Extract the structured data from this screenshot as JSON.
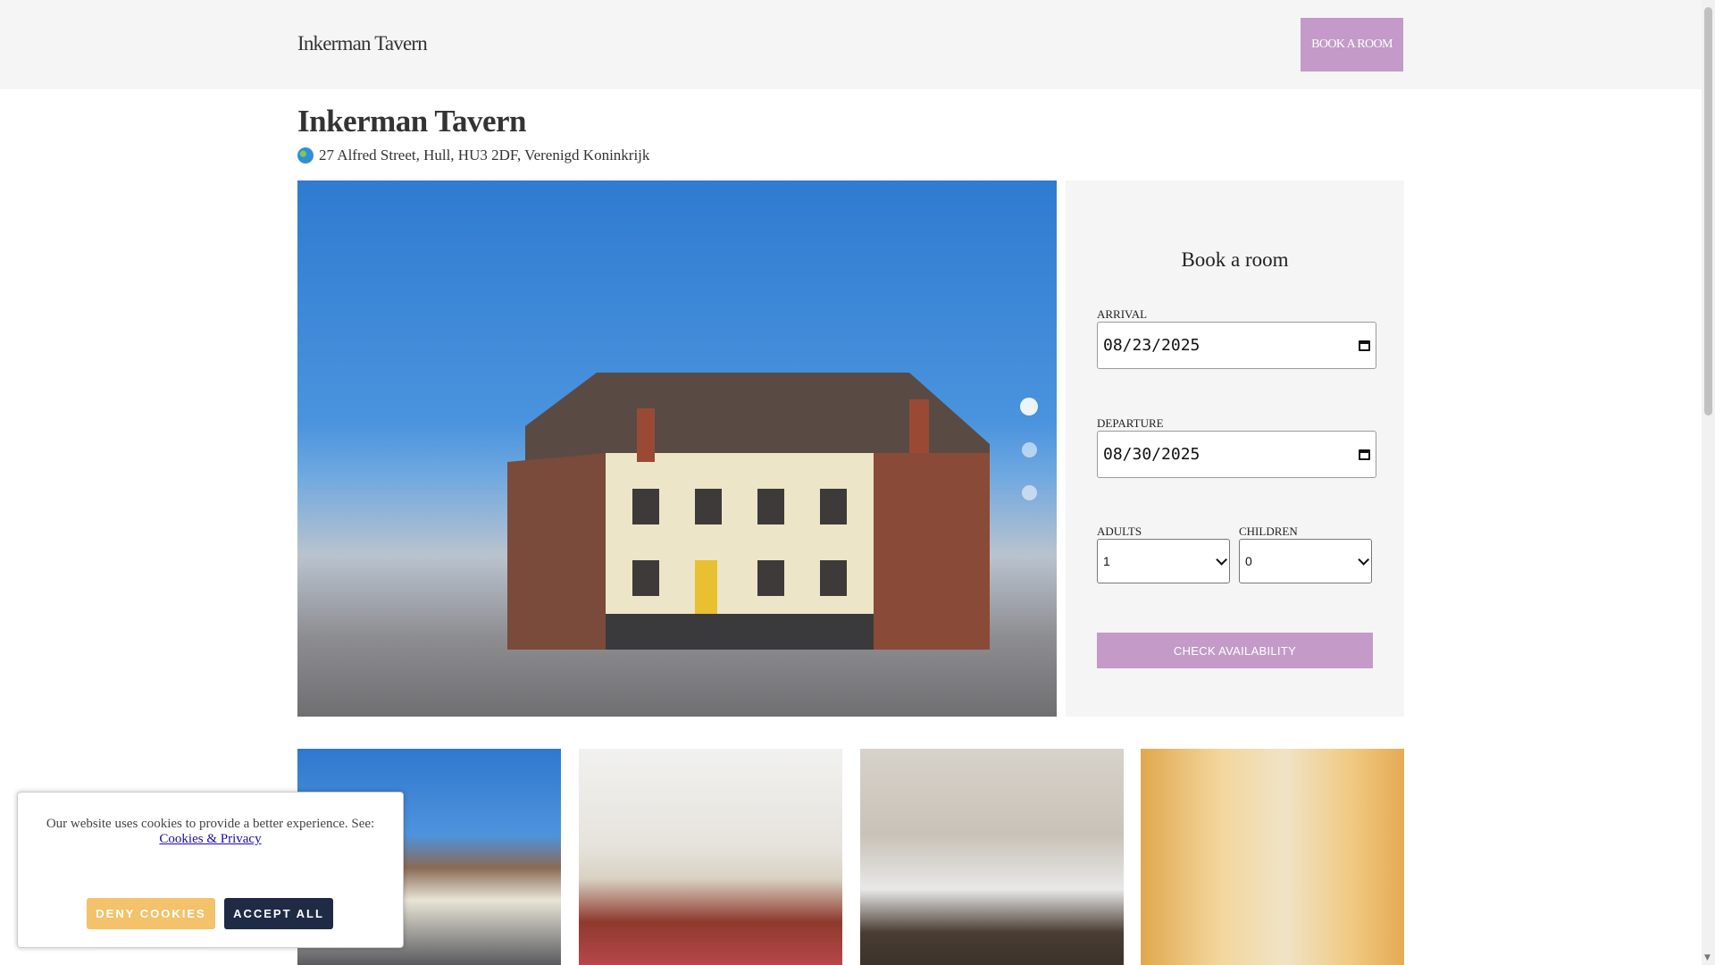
{
  "header": {
    "brand": "Inkerman Tavern",
    "book_button": "BOOK A ROOM"
  },
  "property": {
    "title": "Inkerman Tavern",
    "address": "27 Alfred Street, Hull, HU3 2DF, Verenigd Koninkrijk",
    "address_icon": "globe-icon"
  },
  "booking": {
    "title": "Book a room",
    "arrival_label": "ARRIVAL",
    "arrival_value": "08/23/2025",
    "departure_label": "DEPARTURE",
    "departure_value": "08/30/2025",
    "adults_label": "ADULTS",
    "adults_value": "1",
    "children_label": "CHILDREN",
    "children_value": "0",
    "check_button": "CHECK AVAILABILITY"
  },
  "cookie": {
    "text": "Our website uses cookies to provide a better experience. See:",
    "link": "Cookies & Privacy",
    "deny": "DENY COOKIES",
    "accept": "ACCEPT ALL"
  },
  "colors": {
    "accent": "#c39ac8",
    "deny": "#f4c26a",
    "accept": "#1f2a45"
  }
}
